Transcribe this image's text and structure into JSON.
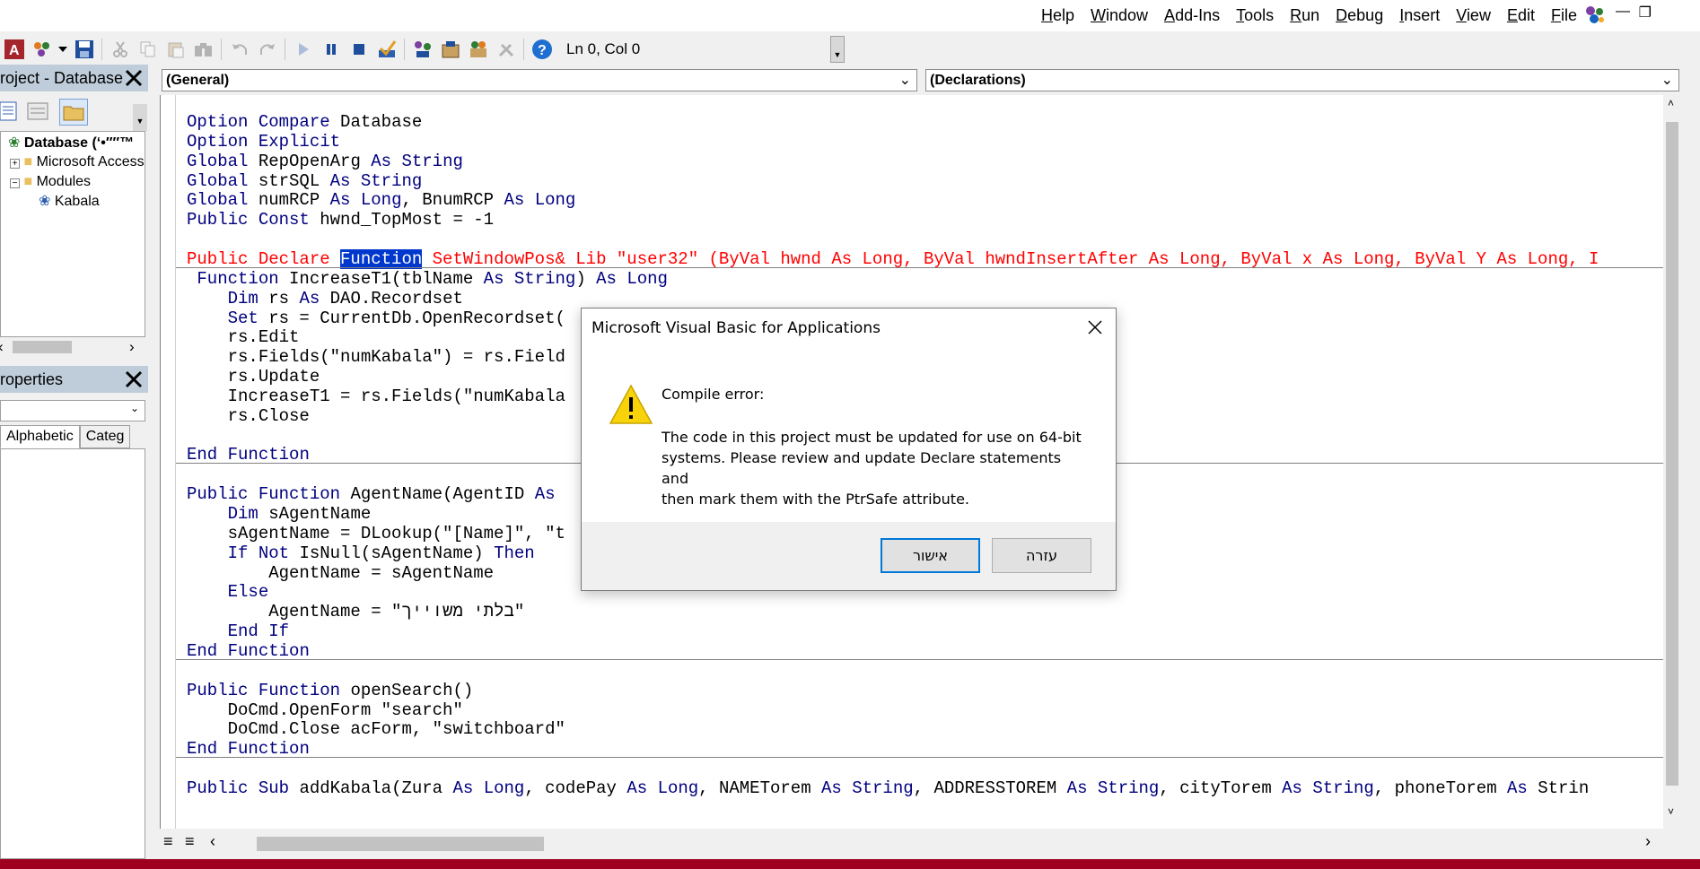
{
  "menu": {
    "items": [
      {
        "label": "Help",
        "accel": "H"
      },
      {
        "label": "Window",
        "accel": "W"
      },
      {
        "label": "Add-Ins",
        "accel": "A"
      },
      {
        "label": "Tools",
        "accel": "T"
      },
      {
        "label": "Run",
        "accel": "R"
      },
      {
        "label": "Debug",
        "accel": "D"
      },
      {
        "label": "Insert",
        "accel": "I"
      },
      {
        "label": "View",
        "accel": "V"
      },
      {
        "label": "Edit",
        "accel": "E"
      },
      {
        "label": "File",
        "accel": "F"
      }
    ]
  },
  "toolbar": {
    "status": "Ln 0, Col 0"
  },
  "project_pane": {
    "title": "roject - Database",
    "tree": {
      "root": "Database (‘•″″™",
      "node1": "Microsoft Access",
      "node2": "Modules",
      "leaf": "Kabala"
    }
  },
  "properties_pane": {
    "title": "roperties",
    "tabs": [
      "Alphabetic",
      "Categ"
    ]
  },
  "code_window": {
    "object_combo": "(General)",
    "procedure_combo": "(Declarations)",
    "lines": [
      "Option Compare Database",
      "Option Explicit",
      "Global RepOpenArg As String",
      "Global strSQL As String",
      "Global numRCP As Long, BnumRCP As Long",
      "Public Const hwnd_TopMost = -1",
      "",
      "Public Declare Function SetWindowPos& Lib \"user32\" (ByVal hwnd As Long, ByVal hwndInsertAfter As Long, ByVal x As Long, ByVal Y As Long, I",
      " Function IncreaseT1(tblName As String) As Long",
      "    Dim rs As DAO.Recordset",
      "    Set rs = CurrentDb.OpenRecordset(",
      "    rs.Edit",
      "    rs.Fields(\"numKabala\") = rs.Field",
      "    rs.Update",
      "    IncreaseT1 = rs.Fields(\"numKabala",
      "    rs.Close",
      "",
      "End Function",
      "",
      "Public Function AgentName(AgentID As",
      "    Dim sAgentName",
      "    sAgentName = DLookup(\"[Name]\", \"t",
      "    If Not IsNull(sAgentName) Then",
      "        AgentName = sAgentName",
      "    Else",
      "        AgentName = \"בלתי משוייך\"",
      "    End If",
      "End Function",
      "",
      "Public Function openSearch()",
      "    DoCmd.OpenForm \"search\"",
      "    DoCmd.Close acForm, \"switchboard\"",
      "End Function",
      "",
      "Public Sub addKabala(Zura As Long, codePay As Long, NAMETorem As String, ADDRESSTOREM As String, cityTorem As String, phoneTorem As Strin"
    ]
  },
  "dialog": {
    "title": "Microsoft Visual Basic for Applications",
    "heading": "Compile error:",
    "message": "The code in this project must be updated for use on 64-bit\nsystems.  Please review and update Declare statements and\nthen mark them with the PtrSafe attribute.",
    "ok_label": "אישור",
    "help_label": "עזרה"
  },
  "colors": {
    "keyword": "#00007f",
    "error_line": "#ff0000",
    "selection": "#0037cc",
    "pane_title": "#bfcddb"
  }
}
